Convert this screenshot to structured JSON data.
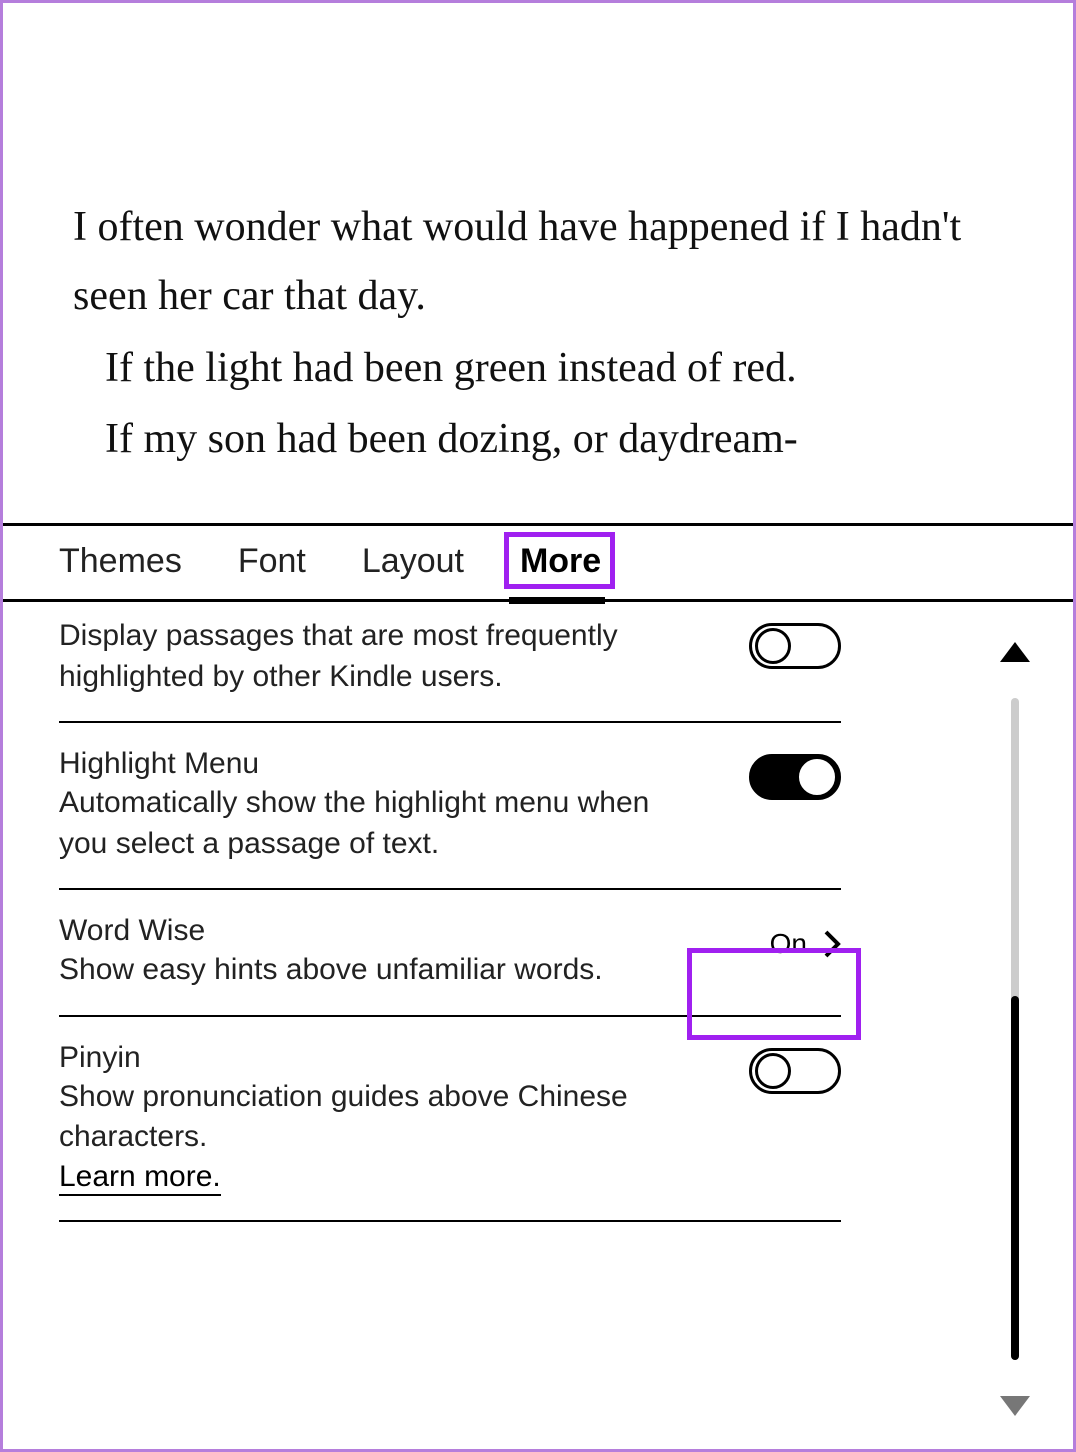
{
  "book": {
    "p1": "I often wonder what would have happened if I hadn't seen her car that day.",
    "p2": "If the light had been green instead of red.",
    "p3": "If my son had been dozing, or daydream-"
  },
  "tabs": {
    "themes": "Themes",
    "font": "Font",
    "layout": "Layout",
    "more": "More"
  },
  "settings": {
    "popular_highlights": {
      "desc": "Display passages that are most frequently highlighted by other Kindle users.",
      "value": false
    },
    "highlight_menu": {
      "title": "Highlight Menu",
      "desc": "Automatically show the highlight menu when you select a passage of text.",
      "value": true
    },
    "word_wise": {
      "title": "Word Wise",
      "desc": "Show easy hints above unfamiliar words.",
      "value_label": "On"
    },
    "pinyin": {
      "title": "Pinyin",
      "desc": "Show pronunciation guides above Chinese characters.",
      "learn_more": "Learn more.",
      "value": false
    }
  }
}
